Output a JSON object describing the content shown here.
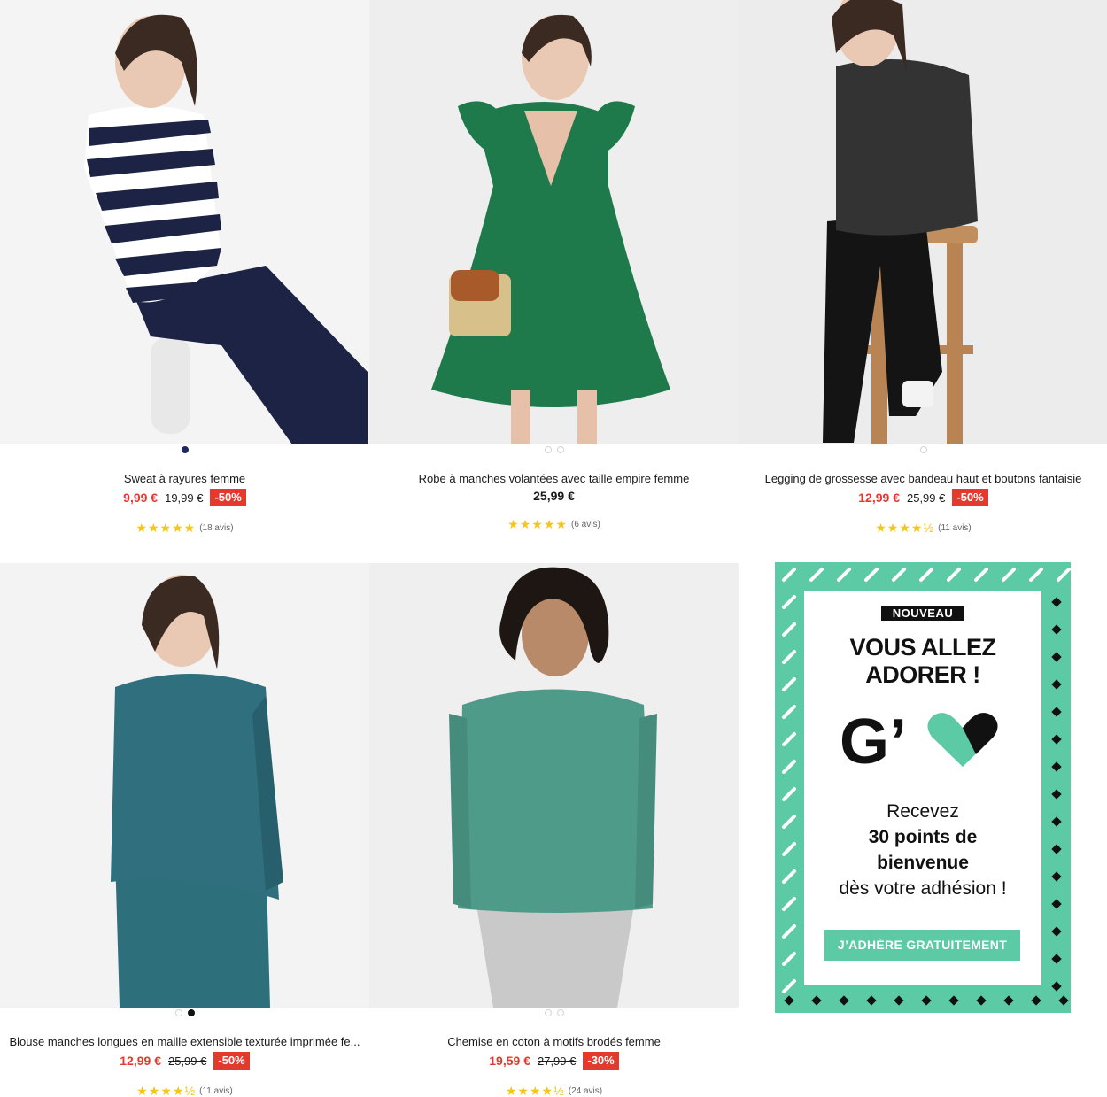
{
  "products": [
    {
      "title": "Sweat à rayures femme",
      "price": "9,99 €",
      "old_price": "19,99 €",
      "discount": "-50%",
      "stars": "★★★★★",
      "reviews": "(18 avis)"
    },
    {
      "title": "Robe à manches volantées avec taille empire femme",
      "price": "25,99 €",
      "stars": "★★★★★",
      "reviews": "(6 avis)"
    },
    {
      "title": "Legging de grossesse avec bandeau haut et boutons fantaisie",
      "price": "12,99 €",
      "old_price": "25,99 €",
      "discount": "-50%",
      "stars": "★★★★½",
      "reviews": "(11 avis)"
    },
    {
      "title": "Blouse manches longues en maille extensible texturée imprimée fe...",
      "price": "12,99 €",
      "old_price": "25,99 €",
      "discount": "-50%",
      "stars": "★★★★½",
      "reviews": "(11 avis)"
    },
    {
      "title": "Chemise en coton à motifs brodés femme",
      "price": "19,59 €",
      "old_price": "27,99 €",
      "discount": "-30%",
      "stars": "★★★★½",
      "reviews": "(24 avis)"
    }
  ],
  "promo": {
    "tag": "NOUVEAU",
    "headline_line1": "VOUS ALLEZ",
    "headline_line2": "ADORER !",
    "logo_text": "G’",
    "line1": "Recevez",
    "line2": "30 points de",
    "line3": "bienvenue",
    "line4": "dès votre adhésion !",
    "cta": "J’ADHÈRE GRATUITEMENT"
  },
  "colors": {
    "sale_red": "#e43a2d",
    "promo_green": "#5ccaa5",
    "star_yellow": "#f5c518"
  }
}
